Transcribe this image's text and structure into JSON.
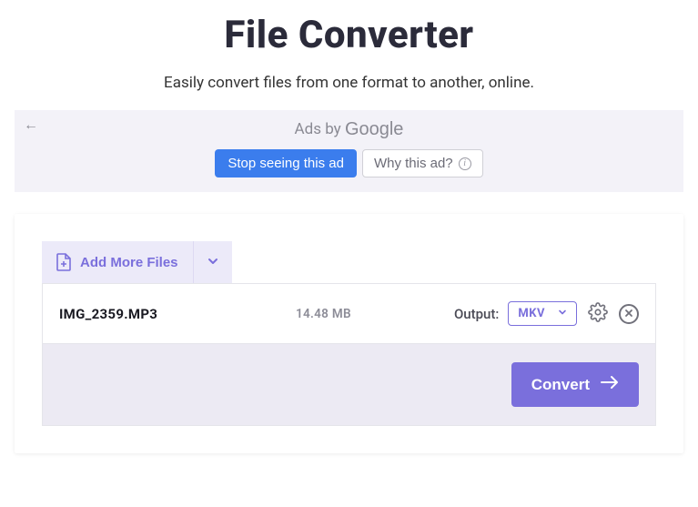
{
  "header": {
    "title": "File Converter",
    "subtitle": "Easily convert files from one format to another, online."
  },
  "ad": {
    "label_prefix": "Ads by ",
    "label_brand": "Google",
    "stop_label": "Stop seeing this ad",
    "why_label": "Why this ad?"
  },
  "toolbar": {
    "add_more_label": "Add More Files"
  },
  "file": {
    "name": "IMG_2359.MP3",
    "size": "14.48 MB",
    "output_label": "Output:",
    "format": "MKV"
  },
  "actions": {
    "convert_label": "Convert"
  }
}
